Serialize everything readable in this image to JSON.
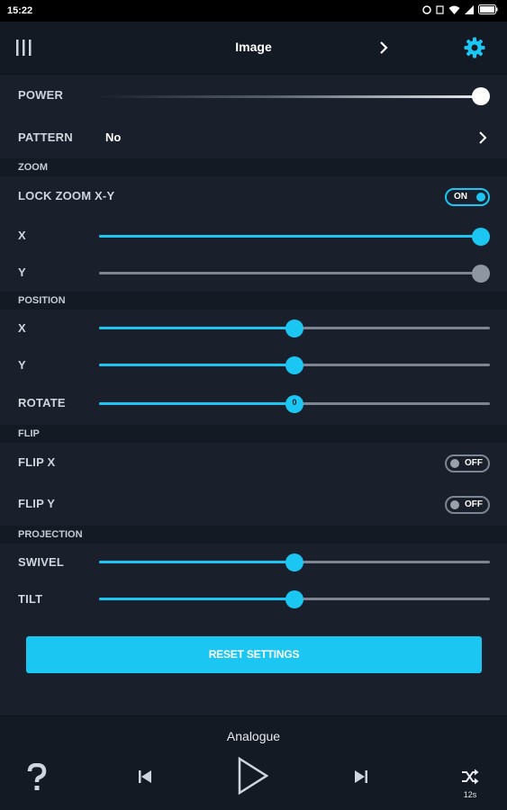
{
  "status_bar": {
    "time": "15:22"
  },
  "header": {
    "title": "Image"
  },
  "rows": {
    "power": {
      "label": "POWER",
      "value": 1.0
    },
    "pattern": {
      "label": "PATTERN",
      "value": "No"
    }
  },
  "zoom": {
    "section": "ZOOM",
    "lock": {
      "label": "LOCK ZOOM X-Y",
      "toggle": "ON"
    },
    "x": {
      "label": "X",
      "value": 1.0
    },
    "y": {
      "label": "Y",
      "value": 1.0
    }
  },
  "position": {
    "section": "POSITION",
    "x": {
      "label": "X",
      "value": 0.5
    },
    "y": {
      "label": "Y",
      "value": 0.5
    },
    "rotate": {
      "label": "ROTATE",
      "value": 0.5,
      "display": "0"
    }
  },
  "flip": {
    "section": "FLIP",
    "x": {
      "label": "FLIP X",
      "toggle": "OFF"
    },
    "y": {
      "label": "FLIP Y",
      "toggle": "OFF"
    }
  },
  "projection": {
    "section": "PROJECTION",
    "swivel": {
      "label": "SWIVEL",
      "value": 0.5
    },
    "tilt": {
      "label": "TILT",
      "value": 0.5
    }
  },
  "reset_button": {
    "label": "RESET SETTINGS"
  },
  "player": {
    "track": "Analogue",
    "timer": "12s"
  },
  "colors": {
    "accent": "#1bc6f2",
    "background": "#1a202b",
    "bar": "#141a24",
    "track_inactive": "#7c8591"
  },
  "icons": [
    "menu-bars-icon",
    "chevron-right-icon",
    "gear-icon",
    "question-icon",
    "skip-previous-icon",
    "play-icon",
    "skip-next-icon",
    "shuffle-icon"
  ]
}
